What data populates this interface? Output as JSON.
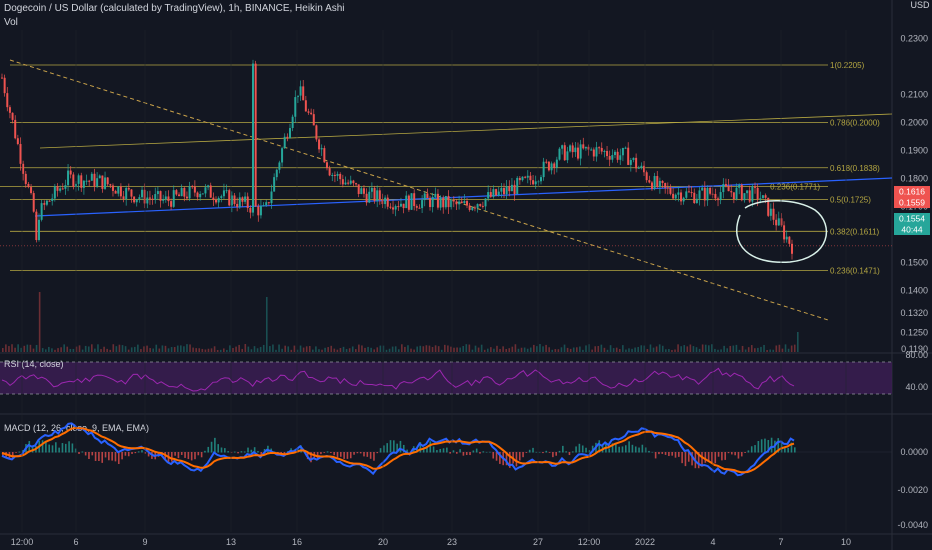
{
  "header": {
    "title": "Dogecoin / US Dollar (calculated by TradingView), 1h, BINANCE, Heikin Ashi",
    "volume_label": "Vol",
    "currency": "USD"
  },
  "colors": {
    "background": "#131722",
    "up": "#26a69a",
    "down": "#ef5350",
    "fib": "#b5a742",
    "trend_blue": "#2962ff",
    "trend_dashed": "#c9a24a",
    "rsi": "#9c27b0",
    "rsi_band": "#3b1d52",
    "macd_line": "#2962ff",
    "signal_line": "#ff6d00",
    "circle": "#d8f0e8",
    "grid": "#2a2e39",
    "text": "#b2b5be"
  },
  "chart_data": [
    {
      "type": "candlestick",
      "title": "Dogecoin / US Dollar (calculated by TradingView), 1h, BINANCE, Heikin Ashi",
      "y_axis": {
        "ticks": [
          "0.2300",
          "0.2100",
          "0.2000",
          "0.1900",
          "0.1800",
          "0.1700",
          "0.1500",
          "0.1400",
          "0.1320",
          "0.1250",
          "0.1190"
        ],
        "price_labels": [
          {
            "label": "0.1616",
            "color": "#ef5350"
          },
          {
            "label": "0.1559",
            "color": "#ef5350"
          },
          {
            "label": "0.1554",
            "color": "#26a69a"
          },
          {
            "label": "40:44",
            "color": "#26a69a"
          }
        ]
      },
      "x_axis": {
        "ticks": [
          "12:00",
          "6",
          "9",
          "13",
          "16",
          "20",
          "23",
          "27",
          "12:00",
          "2022",
          "4",
          "7",
          "10"
        ]
      },
      "series": {
        "x": [
          0,
          4,
          8,
          12,
          16,
          20,
          24,
          28,
          32,
          36,
          40,
          44,
          48,
          52,
          56,
          60,
          64,
          68,
          72,
          76,
          80,
          84,
          88,
          92,
          96
        ],
        "close": [
          0.216,
          0.166,
          0.18,
          0.179,
          0.174,
          0.172,
          0.176,
          0.1725,
          0.168,
          0.212,
          0.182,
          0.1745,
          0.1715,
          0.172,
          0.17,
          0.174,
          0.179,
          0.189,
          0.19,
          0.188,
          0.176,
          0.174,
          0.1755,
          0.174,
          0.156
        ]
      },
      "fibonacci_levels": [
        {
          "label": "1(0.2205)",
          "value": 0.2205
        },
        {
          "label": "0.786(0.2000)",
          "value": 0.2
        },
        {
          "label": "0.618(0.1838)",
          "value": 0.1838
        },
        {
          "label": "0.236(0.1771)",
          "value": 0.1771
        },
        {
          "label": "0.5(0.1725)",
          "value": 0.1725
        },
        {
          "label": "0.382(0.1611)",
          "value": 0.1611
        },
        {
          "label": "0.236(0.1471)",
          "value": 0.1471
        }
      ],
      "annotations": [
        "blue ascending trendline",
        "dashed descending trendline",
        "hand-drawn circle around recent low"
      ]
    },
    {
      "type": "line",
      "title": "RSI (14, close)",
      "y_axis": {
        "ticks": [
          "80.00",
          "40.00"
        ]
      },
      "bands": [
        70,
        30
      ]
    },
    {
      "type": "line",
      "title": "MACD (12, 26, close, 9, EMA, EMA)",
      "y_axis": {
        "ticks": [
          "0.0000",
          "-0.0020",
          "-0.0040"
        ]
      },
      "series": [
        {
          "name": "MACD",
          "color": "#2962ff"
        },
        {
          "name": "Signal",
          "color": "#ff6d00"
        }
      ]
    }
  ]
}
